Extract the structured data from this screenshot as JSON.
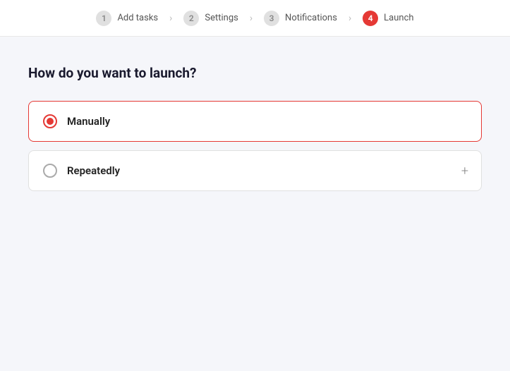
{
  "stepper": {
    "steps": [
      {
        "number": "1",
        "label": "Add tasks",
        "active": false
      },
      {
        "number": "2",
        "label": "Settings",
        "active": false
      },
      {
        "number": "3",
        "label": "Notifications",
        "active": false
      },
      {
        "number": "4",
        "label": "Launch",
        "active": true
      }
    ]
  },
  "main": {
    "question": "How do you want to launch?",
    "options": [
      {
        "label": "Manually",
        "selected": true,
        "has_expand": false
      },
      {
        "label": "Repeatedly",
        "selected": false,
        "has_expand": true
      }
    ]
  }
}
